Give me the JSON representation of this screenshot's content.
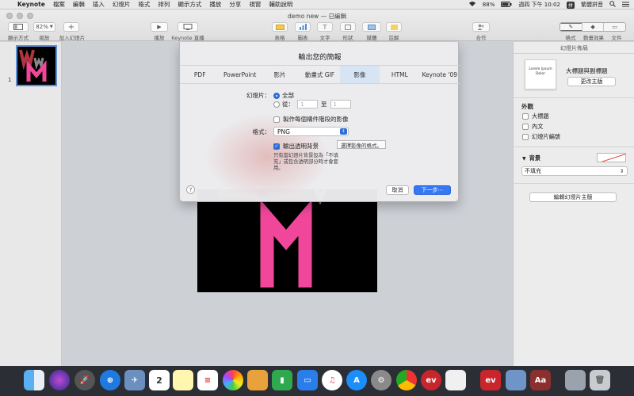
{
  "menubar": {
    "app": "Keynote",
    "items": [
      "檔案",
      "編輯",
      "插入",
      "幻燈片",
      "格式",
      "排列",
      "顯示方式",
      "播放",
      "分享",
      "視窗",
      "輔助說明"
    ],
    "battery": "88%",
    "clock": "週四 下午 10:02",
    "input_method": "繁體拼音"
  },
  "window": {
    "title": "demo new — 已編輯"
  },
  "toolbar": {
    "view_label": "顯示方式",
    "zoom_value": "82%",
    "zoom_label": "縮放",
    "add_slide_label": "加入幻燈片",
    "play_label": "播放",
    "keynote_live_label": "Keynote 直播",
    "table_label": "表格",
    "chart_label": "圖表",
    "text_label": "文字",
    "shape_label": "形狀",
    "media_label": "媒體",
    "comment_label": "註解",
    "collab_label": "合作",
    "format_label": "格式",
    "animate_label": "動畫效果",
    "document_label": "文件"
  },
  "navigator": {
    "slide_number": "1"
  },
  "dialog": {
    "title": "輸出您的簡報",
    "tabs": [
      "PDF",
      "PowerPoint",
      "影片",
      "動畫式 GIF",
      "影像",
      "HTML",
      "Keynote '09"
    ],
    "active_tab": "影像",
    "slides_label": "幻燈片：",
    "all_label": "全部",
    "from_label": "從：",
    "from_value": "1",
    "to_label": "至",
    "to_value": "1",
    "build_checkbox": "製作每個構件階段的影像",
    "format_label": "格式：",
    "format_value": "PNG",
    "transparent_checkbox": "輸出透明背景",
    "tooltip": "選擇影像的格式。",
    "note": "只有當幻燈片背景設為「不填充」或包含透明部分時才會套用。",
    "help": "?",
    "cancel": "取消",
    "next": "下一步⋯"
  },
  "inspector": {
    "title": "幻燈片佈局",
    "layout_preview": "Lorem Ipsum Dolor",
    "layout_name": "大標題與副標題",
    "change_master": "更改主版",
    "appearance": "外觀",
    "opt_title": "大標題",
    "opt_body": "內文",
    "opt_number": "幻燈片編號",
    "background": "背景",
    "fill_value": "不填充",
    "edit_master": "編輯幻燈片主版"
  },
  "colors": {
    "accent": "#3478f6",
    "slide_pink": "#f0479a"
  }
}
